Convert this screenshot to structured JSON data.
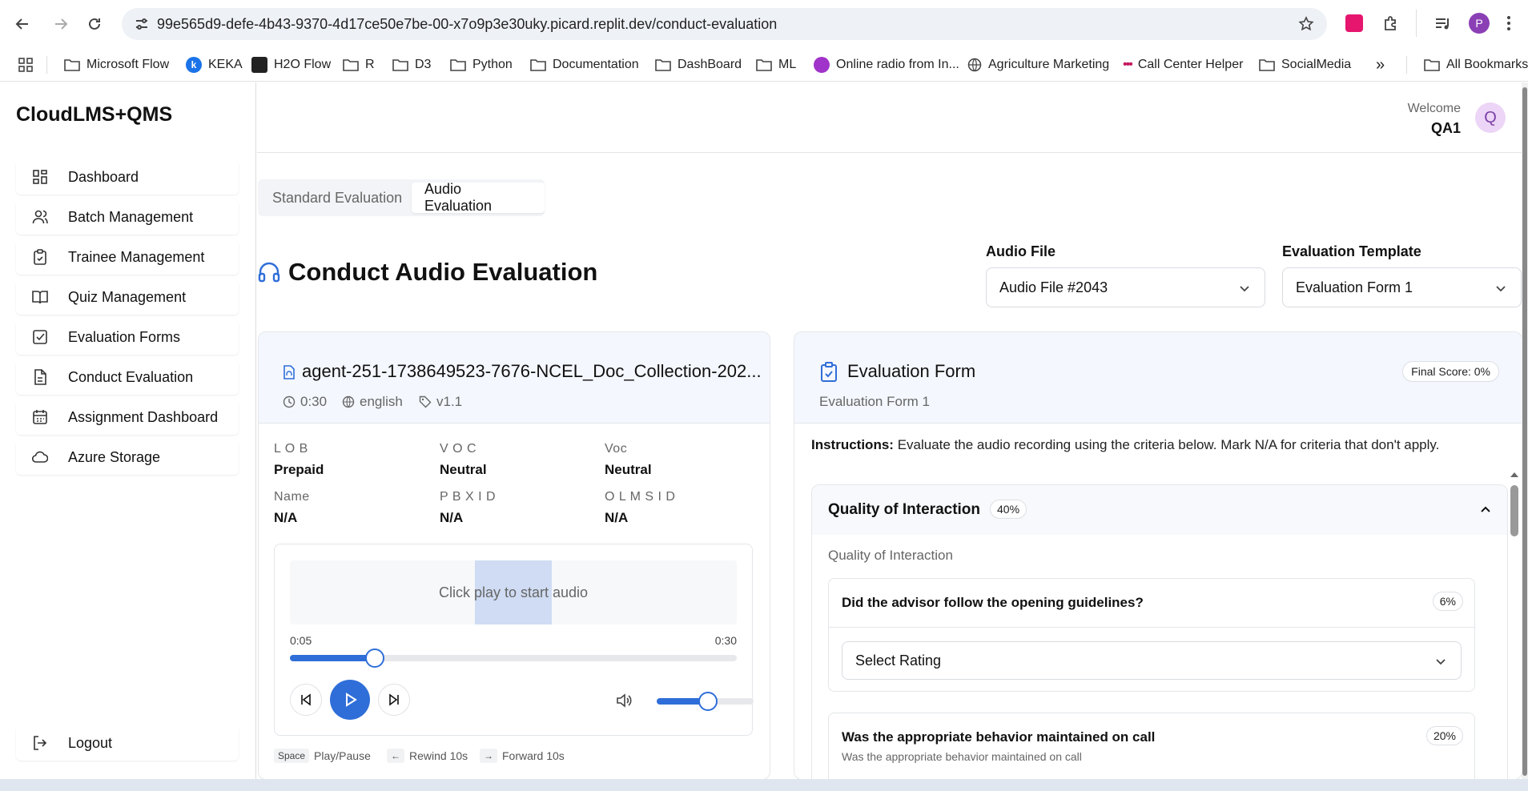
{
  "browser": {
    "url": "99e565d9-defe-4b43-9370-4d17ce50e7be-00-x7o9p3e30uky.picard.replit.dev/conduct-evaluation",
    "profile_initial": "P",
    "bookmarks": [
      "Microsoft Flow",
      "KEKA",
      "H2O Flow",
      "R",
      "D3",
      "Python",
      "Documentation",
      "DashBoard",
      "ML",
      "Online radio from In...",
      "Agriculture Marketing",
      "Call Center Helper",
      "SocialMedia"
    ],
    "all_bookmarks": "All Bookmarks",
    "more": "»"
  },
  "sidebar": {
    "logo": "CloudLMS+QMS",
    "items": [
      {
        "label": "Dashboard",
        "icon": "grid-icon"
      },
      {
        "label": "Batch Management",
        "icon": "users-icon"
      },
      {
        "label": "Trainee Management",
        "icon": "clipboard-check-icon"
      },
      {
        "label": "Quiz Management",
        "icon": "book-icon"
      },
      {
        "label": "Evaluation Forms",
        "icon": "checkbox-icon"
      },
      {
        "label": "Conduct Evaluation",
        "icon": "file-icon"
      },
      {
        "label": "Assignment Dashboard",
        "icon": "calendar-icon"
      },
      {
        "label": "Azure Storage",
        "icon": "cloud-icon"
      }
    ],
    "logout": "Logout"
  },
  "header": {
    "welcome": "Welcome",
    "user": "QA1",
    "avatar_initial": "Q"
  },
  "tabs": {
    "standard": "Standard Evaluation",
    "audio": "Audio Evaluation",
    "active": "audio"
  },
  "page": {
    "title": "Conduct Audio Evaluation",
    "audio_file_label": "Audio File",
    "audio_file_value": "Audio File #2043",
    "template_label": "Evaluation Template",
    "template_value": "Evaluation Form 1"
  },
  "audio": {
    "name": "agent-251-1738649523-7676-NCEL_Doc_Collection-202...",
    "duration": "0:30",
    "language": "english",
    "version": "v1.1",
    "fields": [
      {
        "label": "L O B",
        "value": "Prepaid"
      },
      {
        "label": "V O C",
        "value": "Neutral"
      },
      {
        "label": "Voc",
        "value": "Neutral"
      },
      {
        "label": "Name",
        "value": "N/A"
      },
      {
        "label": "P B X I D",
        "value": "N/A"
      },
      {
        "label": "O L M S I D",
        "value": "N/A"
      }
    ],
    "placeholder": "Click play to start audio",
    "current_time": "0:05",
    "total_time": "0:30",
    "progress": 0.19,
    "volume": 0.53,
    "shortcuts": [
      {
        "key": "Space",
        "label": "Play/Pause"
      },
      {
        "key": "←",
        "label": "Rewind 10s"
      },
      {
        "key": "→",
        "label": "Forward 10s"
      }
    ]
  },
  "evaluation": {
    "title": "Evaluation Form",
    "subtitle": "Evaluation Form 1",
    "final_score": "Final Score: 0%",
    "instructions_label": "Instructions:",
    "instructions": "Evaluate the audio recording using the criteria below. Mark N/A for criteria that don't apply.",
    "section": {
      "title": "Quality of Interaction",
      "weight": "40%",
      "subtitle": "Quality of Interaction",
      "questions": [
        {
          "text": "Did the advisor follow the opening guidelines?",
          "weight": "6%",
          "rating_placeholder": "Select Rating"
        },
        {
          "text": "Was the appropriate behavior maintained on call",
          "weight": "20%",
          "description": "Was the appropriate behavior maintained on call"
        }
      ]
    }
  },
  "colors": {
    "accent": "#2f6ed8",
    "header_bg": "#f4f7fd"
  }
}
